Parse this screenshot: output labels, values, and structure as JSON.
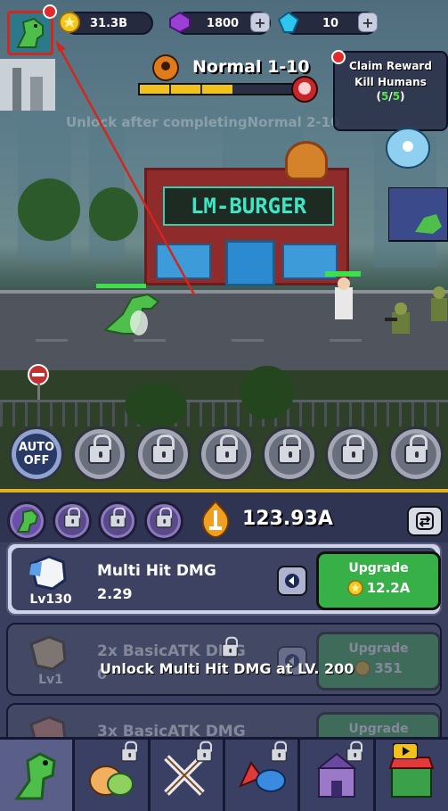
{
  "hud": {
    "gold": "31.3B",
    "gems": "1800",
    "crystals": "10",
    "gold_icon": "gold-coin-icon",
    "gem_icon": "purple-gem-icon",
    "crystal_icon": "blue-crystal-icon"
  },
  "stage": {
    "title": "Normal 1-10",
    "progress_segments": 5,
    "progress_filled": 3,
    "unlock_message": "Unlock after completingNormal 2-10",
    "store_sign": "LM-BURGER"
  },
  "quest": {
    "title": "Claim Reward",
    "task": "Kill Humans",
    "progress_done": "5",
    "progress_total": "5"
  },
  "skills": {
    "auto_label": "AUTO",
    "auto_state": "OFF",
    "locked_slots": 6
  },
  "panel": {
    "attack_value": "123.93A",
    "locked_tabs": 3
  },
  "upgrades": [
    {
      "name": "Multi Hit DMG",
      "level": "Lv130",
      "value": "2.29",
      "button": "Upgrade",
      "cost": "12.2A",
      "locked": false
    },
    {
      "name": "2x BasicATK DMG",
      "level": "Lv1",
      "value": "0",
      "button": "Upgrade",
      "cost": "351",
      "locked": true
    },
    {
      "name": "3x BasicATK DMG",
      "level": "",
      "value": "",
      "button": "Upgrade",
      "cost": "",
      "locked": true
    }
  ],
  "unlock_note": "Unlock Multi Hit DMG at LV. 200",
  "colors": {
    "accent_gold": "#f1c21b",
    "upgrade_green": "#38b048",
    "alert_red": "#e22a2a"
  },
  "nav": [
    {
      "name": "monster",
      "icon": "dinosaur-icon",
      "locked": false
    },
    {
      "name": "pets",
      "icon": "slime-pets-icon",
      "locked": true
    },
    {
      "name": "equipment",
      "icon": "crossed-swords-icon",
      "locked": true
    },
    {
      "name": "skills",
      "icon": "fire-bird-icon",
      "locked": true
    },
    {
      "name": "castle",
      "icon": "castle-icon",
      "locked": true
    },
    {
      "name": "shop",
      "icon": "shop-icon",
      "locked": false
    }
  ]
}
